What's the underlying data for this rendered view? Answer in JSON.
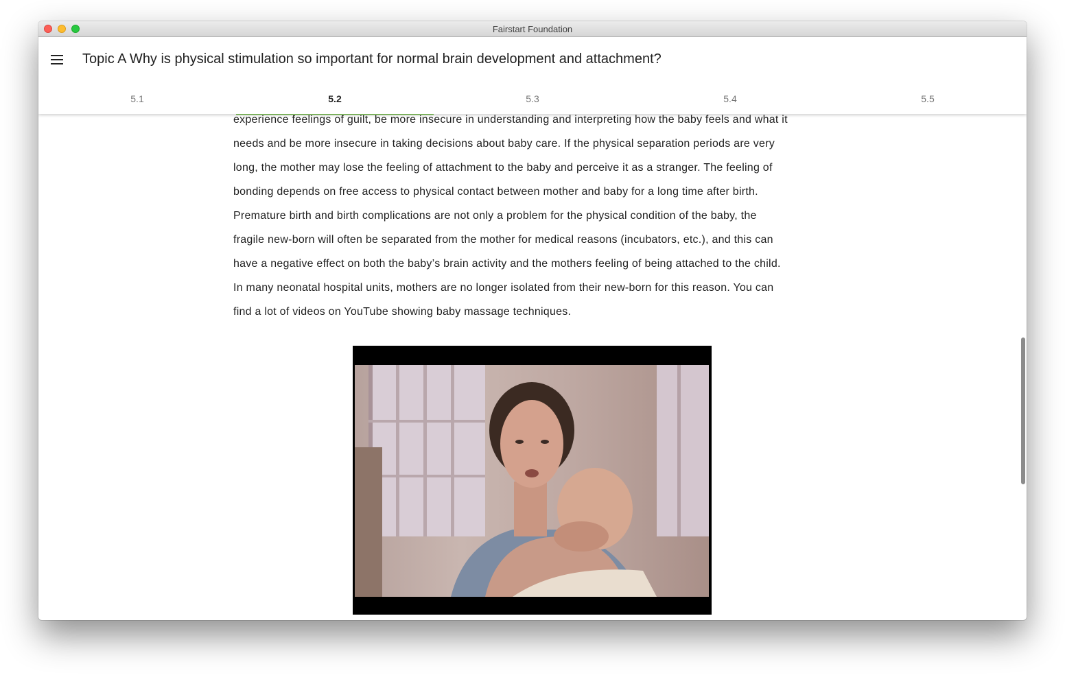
{
  "window": {
    "title": "Fairstart Foundation",
    "traffic_lights": {
      "close": "#fc5f57",
      "minimize": "#fdbc2e",
      "maximize": "#28c840"
    }
  },
  "header": {
    "menu_icon": "hamburger-menu-icon",
    "title": "Topic A Why is physical stimulation so important for normal brain development and attachment?"
  },
  "tabs": [
    {
      "label": "5.1",
      "active": false
    },
    {
      "label": "5.2",
      "active": true
    },
    {
      "label": "5.3",
      "active": false
    },
    {
      "label": "5.4",
      "active": false
    },
    {
      "label": "5.5",
      "active": false
    }
  ],
  "accent_color": "#7cb15e",
  "content": {
    "lines": [
      "experience feelings of guilt, be more insecure in understanding and interpreting how the baby feels and what it",
      "needs and be more insecure in taking decisions about baby care. If the physical separation periods are very",
      "long, the mother may lose the feeling of attachment to the baby and perceive it as a stranger. The feeling of",
      "bonding depends on free access to physical contact between mother and baby for a long time after birth.",
      "Premature birth and birth complications are not only a problem for the physical condition of the baby, the",
      "fragile new-born will often be separated from the mother for medical reasons (incubators, etc.), and this can",
      "have a negative effect on both the baby’s brain activity and the mothers feeling of being attached to the child.",
      "In many neonatal hospital units, mothers are no longer isolated from their new-born for this reason. You can",
      "find a lot of videos on YouTube showing baby massage techniques."
    ],
    "video": {
      "description_icon": "video-frame"
    }
  }
}
